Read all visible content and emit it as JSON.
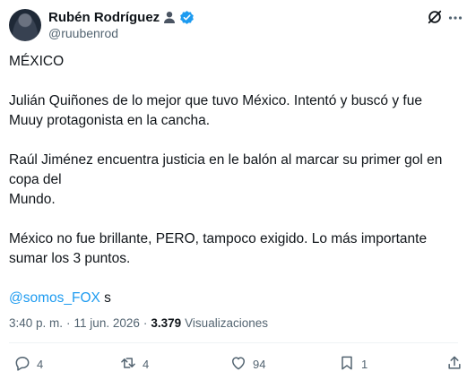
{
  "author": {
    "name": "Rubén Rodríguez",
    "handle": "@ruubenrod"
  },
  "tweet": {
    "paragraphs": [
      "MÉXICO",
      "Julián Quiñones de lo mejor que tuvo México. Intentó y buscó y fue Muuy protagonista en la cancha.",
      "Raúl Jiménez encuentra justicia en le balón al marcar su primer gol en copa del\nMundo.",
      "México no fue brillante, PERO, tampoco exigido. Lo más importante sumar los 3 puntos."
    ],
    "mention": "@somos_FOX",
    "mention_suffix": " s"
  },
  "meta": {
    "time": "3:40 p. m.",
    "separator": "·",
    "date": "11 jun. 2026",
    "views_count": "3.379",
    "views_label": "Visualizaciones"
  },
  "actions": {
    "replies": "4",
    "reposts": "4",
    "likes": "94",
    "bookmarks": "1"
  },
  "colors": {
    "text": "#0f1419",
    "secondary": "#536471",
    "accent": "#1d9bf0",
    "divider": "#eff3f4"
  }
}
